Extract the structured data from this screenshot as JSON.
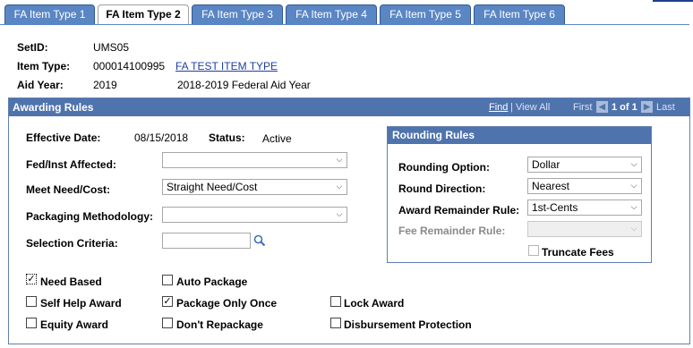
{
  "tabs": [
    {
      "label": "FA Item Type 1",
      "active": false
    },
    {
      "label": "FA Item Type 2",
      "active": true
    },
    {
      "label": "FA Item Type 3",
      "active": false
    },
    {
      "label": "FA Item Type 4",
      "active": false
    },
    {
      "label": "FA Item Type 5",
      "active": false
    },
    {
      "label": "FA Item Type 6",
      "active": false
    }
  ],
  "header": {
    "setid_label": "SetID:",
    "setid_value": "UMS05",
    "item_type_label": "Item Type:",
    "item_type_value": "000014100995",
    "item_type_link": "FA TEST ITEM TYPE",
    "aid_year_label": "Aid Year:",
    "aid_year_value": "2019",
    "aid_year_desc": "2018-2019 Federal Aid Year"
  },
  "panel": {
    "title": "Awarding Rules",
    "nav": {
      "find": "Find",
      "separator": "|",
      "view_all": "View All",
      "first": "First",
      "count": "1 of 1",
      "last": "Last"
    },
    "effective_date_label": "Effective Date:",
    "effective_date_value": "08/15/2018",
    "status_label": "Status:",
    "status_value": "Active",
    "fed_inst_label": "Fed/Inst Affected:",
    "fed_inst_value": "",
    "meet_need_label": "Meet Need/Cost:",
    "meet_need_value": "Straight Need/Cost",
    "packaging_label": "Packaging Methodology:",
    "packaging_value": "",
    "selection_label": "Selection Criteria:",
    "selection_value": ""
  },
  "rounding": {
    "title": "Rounding Rules",
    "option_label": "Rounding Option:",
    "option_value": "Dollar",
    "direction_label": "Round Direction:",
    "direction_value": "Nearest",
    "remainder_label": "Award Remainder Rule:",
    "remainder_value": "1st-Cents",
    "fee_label": "Fee Remainder Rule:",
    "fee_value": "",
    "truncate_label": "Truncate Fees",
    "truncate_checked": false
  },
  "checkboxes": {
    "need_based": {
      "label": "Need Based",
      "checked": true
    },
    "auto_package": {
      "label": "Auto Package",
      "checked": false
    },
    "self_help": {
      "label": "Self Help Award",
      "checked": false
    },
    "package_once": {
      "label": "Package Only Once",
      "checked": true
    },
    "lock_award": {
      "label": "Lock Award",
      "checked": false
    },
    "equity_award": {
      "label": "Equity Award",
      "checked": false
    },
    "dont_repackage": {
      "label": "Don't Repackage",
      "checked": false
    },
    "disbursement_protection": {
      "label": "Disbursement Protection",
      "checked": false
    }
  },
  "colors": {
    "tab_blue": "#5b86c4",
    "header_blue": "#4f73ad",
    "link_blue": "#1f3f9f"
  }
}
